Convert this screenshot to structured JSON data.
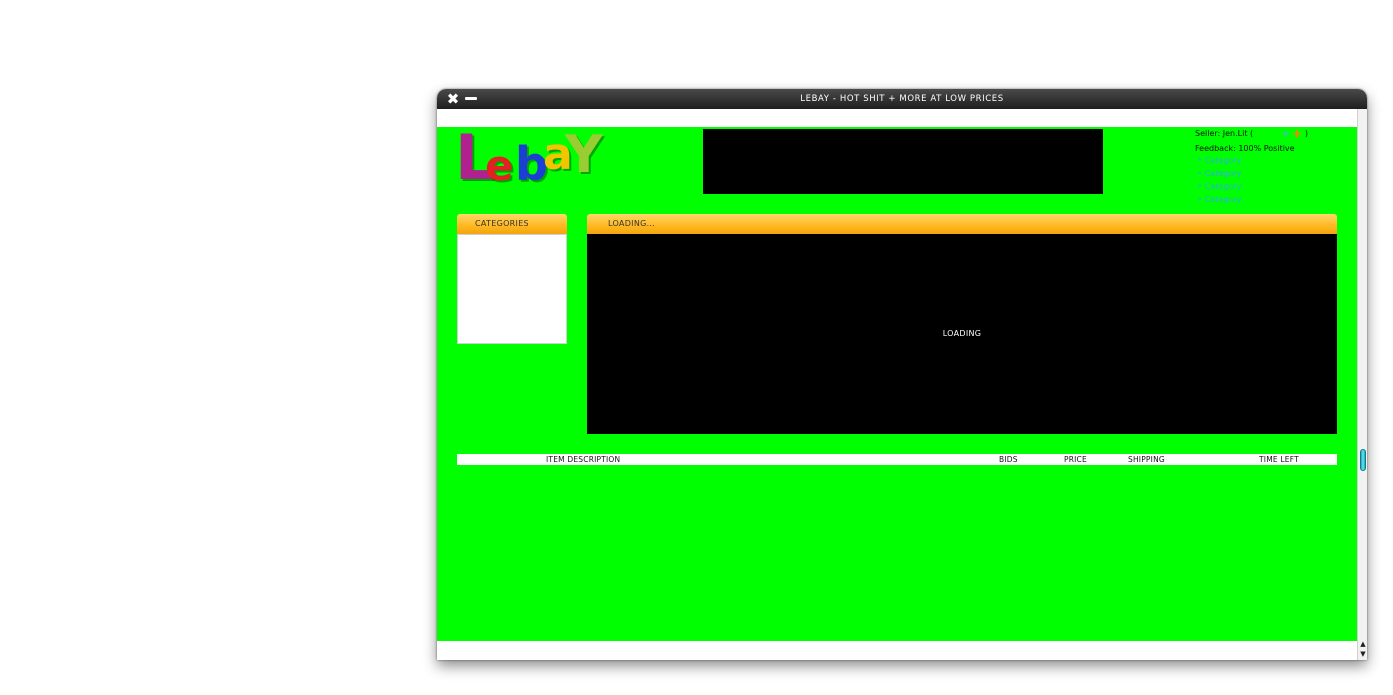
{
  "window": {
    "title": "LEBAY - HOT SHIT + MORE AT LOW PRICES",
    "close_glyph": "✖",
    "scroll_up_glyph": "▲",
    "scroll_down_glyph": "▼"
  },
  "logo": {
    "letters": [
      "L",
      "e",
      "b",
      "a",
      "Y"
    ],
    "colors": [
      "#b0208e",
      "#e52020",
      "#1b3fd4",
      "#f5c400",
      "#9acd32"
    ]
  },
  "seller": {
    "label": "Seller: Jen.Lit (",
    "rating_mark": "★",
    "plus": "+",
    "close_paren": ")",
    "feedback": "Feedback: 100% Positive"
  },
  "category_links": [
    "Category",
    "Category",
    "Category",
    "Category"
  ],
  "categories_panel": {
    "title": "CATEGORIES"
  },
  "main_panel": {
    "title": "LOADING...",
    "body_text": "LOADING"
  },
  "table": {
    "columns": [
      "ITEM DESCRIPTION",
      "BIDS",
      "PRICE",
      "SHIPPING",
      "TIME LEFT"
    ]
  },
  "colors": {
    "page_background": "#00ff00",
    "panel_header": "#ffb81f",
    "link": "#2ab0e0",
    "scroll_thumb": "#29c6d6"
  }
}
